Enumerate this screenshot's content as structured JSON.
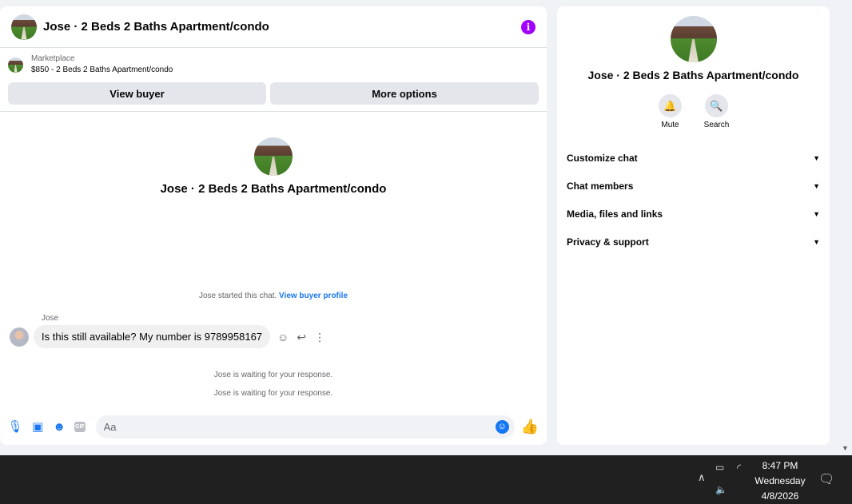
{
  "chat": {
    "title": "Jose · 2 Beds 2 Baths Apartment/condo",
    "marketplace_label": "Marketplace",
    "listing": "$850 - 2 Beds 2 Baths Apartment/condo",
    "view_buyer_label": "View buyer",
    "more_options_label": "More options",
    "intro_title": "Jose · 2 Beds 2 Baths Apartment/condo",
    "started_text": "Jose started this chat.",
    "view_profile_link": "View buyer profile",
    "sender_name": "Jose",
    "message": "Is this still available? My number is 9789958167",
    "waiting_1": "Jose is waiting for your response.",
    "waiting_2": "Jose is waiting for your response.",
    "composer_placeholder": "Aa",
    "gif_label": "GIF"
  },
  "side": {
    "title": "Jose · 2 Beds 2 Baths Apartment/condo",
    "mute_label": "Mute",
    "search_label": "Search",
    "items": [
      {
        "label": "Customize chat"
      },
      {
        "label": "Chat members"
      },
      {
        "label": "Media, files and links"
      },
      {
        "label": "Privacy & support"
      }
    ]
  },
  "taskbar": {
    "time": "8:47 PM",
    "day": "Wednesday",
    "date": "4/8/2026"
  },
  "colors": {
    "accent": "#1877f2",
    "info": "#a100ff",
    "bubble": "#f0f0f0",
    "taskbar": "#202020"
  }
}
